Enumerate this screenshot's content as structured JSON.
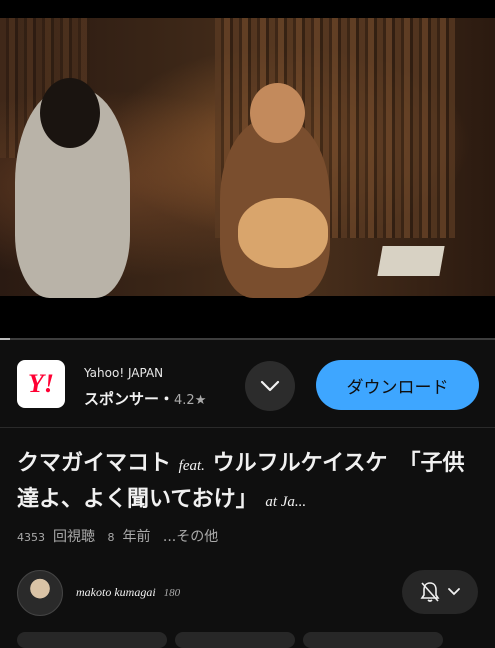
{
  "ad": {
    "brand": "Yahoo! JAPAN",
    "sponsor_label": "スポンサー・",
    "rating": "4.2★",
    "logo_text": "Y!",
    "download_label": "ダウンロード",
    "chevron_icon": "chevron-down-icon"
  },
  "video": {
    "title_part1": "クマガイマコト ",
    "title_feat": "feat.",
    "title_part2": " ウルフルケイスケ　「子供達よ、よく聞いておけ」 ",
    "title_at": "at Ja...",
    "views_count": "4353",
    "views_label": "回視聴",
    "age_count": "8",
    "age_label": "年前",
    "more_label": "...その他",
    "progress": 0.02
  },
  "channel": {
    "name": "makoto kumagai",
    "subscribers": "180",
    "bell_icon": "bell-off-icon"
  }
}
